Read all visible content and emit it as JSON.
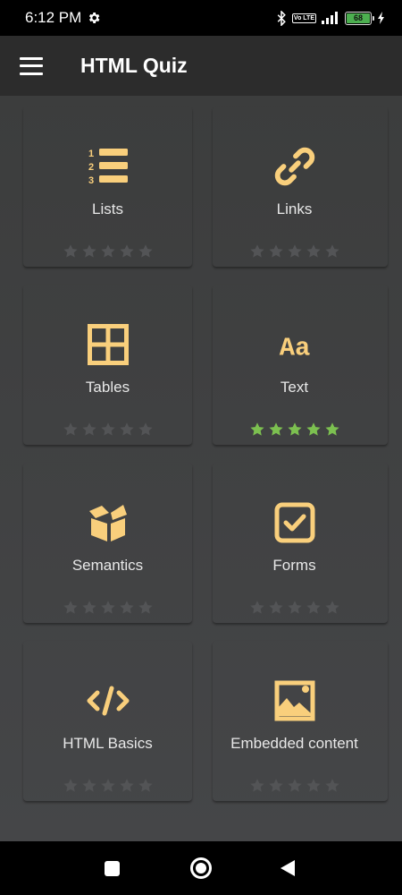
{
  "status": {
    "time": "6:12 PM",
    "lte": "Vo LTE",
    "battery": "68",
    "icons": [
      "settings-gear-icon",
      "bluetooth-icon",
      "volte-icon",
      "signal-icon",
      "battery-icon",
      "charging-icon"
    ]
  },
  "app_bar": {
    "title": "HTML Quiz",
    "menu_icon": "hamburger-menu-icon"
  },
  "colors": {
    "accent": "#f9cf7c",
    "star_empty": "#535456",
    "star_filled": "#7cc050",
    "app_bar": "#2c2c2c",
    "background": "#3f4041"
  },
  "tiles": [
    {
      "label": "Lists",
      "icon": "numbered-list-icon",
      "rating": 0,
      "max_rating": 5
    },
    {
      "label": "Links",
      "icon": "link-chain-icon",
      "rating": 0,
      "max_rating": 5
    },
    {
      "label": "Tables",
      "icon": "table-grid-icon",
      "rating": 0,
      "max_rating": 5
    },
    {
      "label": "Text",
      "icon": "text-aa-icon",
      "rating": 5,
      "max_rating": 5
    },
    {
      "label": "Semantics",
      "icon": "open-box-icon",
      "rating": 0,
      "max_rating": 5
    },
    {
      "label": "Forms",
      "icon": "checkbox-icon",
      "rating": 0,
      "max_rating": 5
    },
    {
      "label": "HTML Basics",
      "icon": "code-brackets-icon",
      "rating": 0,
      "max_rating": 5
    },
    {
      "label": "Embedded content",
      "icon": "image-icon",
      "rating": 0,
      "max_rating": 5
    }
  ],
  "text_icon_glyph": "Aa",
  "list_icon_numbers": [
    "1",
    "2",
    "3"
  ],
  "nav_bar": [
    "recents-square-icon",
    "home-circle-icon",
    "back-triangle-icon"
  ]
}
